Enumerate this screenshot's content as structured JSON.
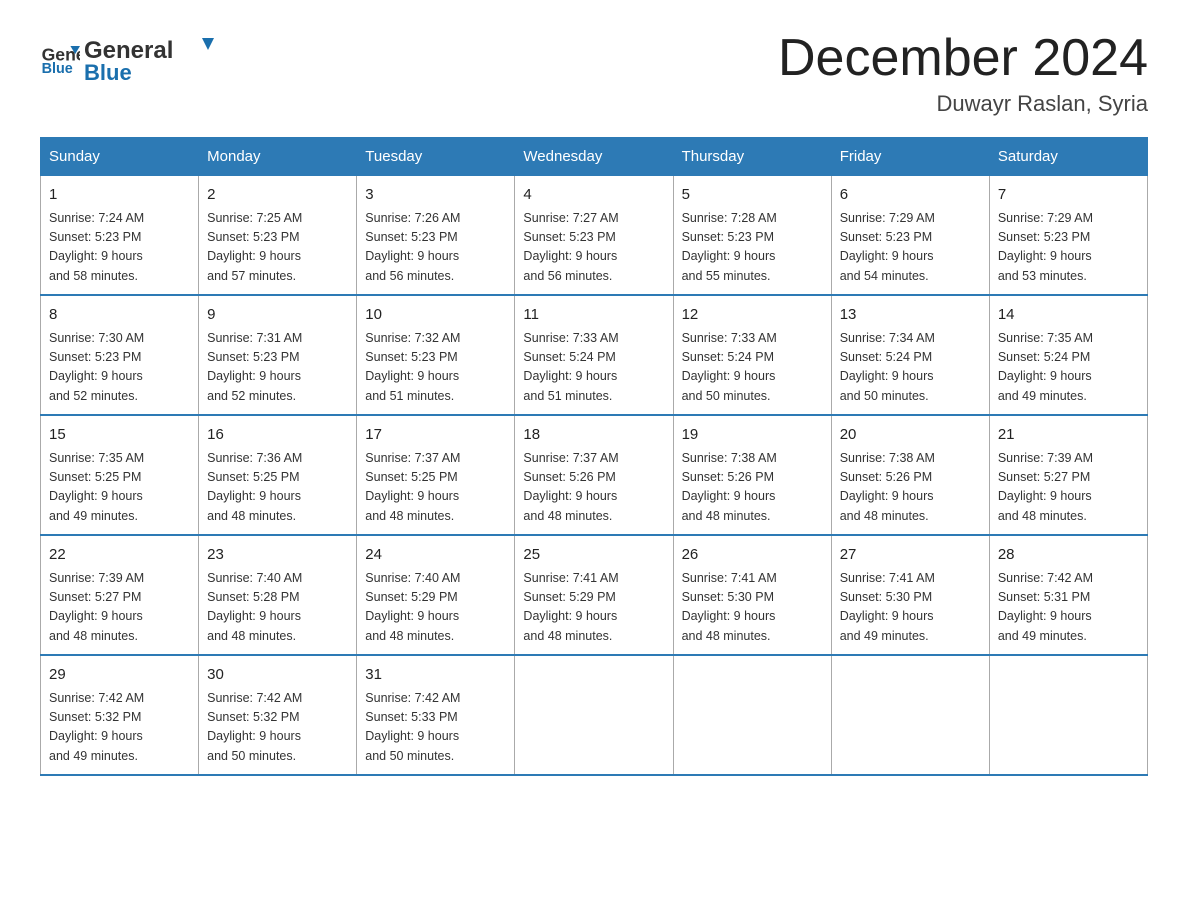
{
  "header": {
    "logo_line1": "General",
    "logo_line2": "Blue",
    "month_title": "December 2024",
    "location": "Duwayr Raslan, Syria"
  },
  "days_of_week": [
    "Sunday",
    "Monday",
    "Tuesday",
    "Wednesday",
    "Thursday",
    "Friday",
    "Saturday"
  ],
  "weeks": [
    [
      {
        "day": "1",
        "sunrise": "7:24 AM",
        "sunset": "5:23 PM",
        "daylight": "9 hours and 58 minutes."
      },
      {
        "day": "2",
        "sunrise": "7:25 AM",
        "sunset": "5:23 PM",
        "daylight": "9 hours and 57 minutes."
      },
      {
        "day": "3",
        "sunrise": "7:26 AM",
        "sunset": "5:23 PM",
        "daylight": "9 hours and 56 minutes."
      },
      {
        "day": "4",
        "sunrise": "7:27 AM",
        "sunset": "5:23 PM",
        "daylight": "9 hours and 56 minutes."
      },
      {
        "day": "5",
        "sunrise": "7:28 AM",
        "sunset": "5:23 PM",
        "daylight": "9 hours and 55 minutes."
      },
      {
        "day": "6",
        "sunrise": "7:29 AM",
        "sunset": "5:23 PM",
        "daylight": "9 hours and 54 minutes."
      },
      {
        "day": "7",
        "sunrise": "7:29 AM",
        "sunset": "5:23 PM",
        "daylight": "9 hours and 53 minutes."
      }
    ],
    [
      {
        "day": "8",
        "sunrise": "7:30 AM",
        "sunset": "5:23 PM",
        "daylight": "9 hours and 52 minutes."
      },
      {
        "day": "9",
        "sunrise": "7:31 AM",
        "sunset": "5:23 PM",
        "daylight": "9 hours and 52 minutes."
      },
      {
        "day": "10",
        "sunrise": "7:32 AM",
        "sunset": "5:23 PM",
        "daylight": "9 hours and 51 minutes."
      },
      {
        "day": "11",
        "sunrise": "7:33 AM",
        "sunset": "5:24 PM",
        "daylight": "9 hours and 51 minutes."
      },
      {
        "day": "12",
        "sunrise": "7:33 AM",
        "sunset": "5:24 PM",
        "daylight": "9 hours and 50 minutes."
      },
      {
        "day": "13",
        "sunrise": "7:34 AM",
        "sunset": "5:24 PM",
        "daylight": "9 hours and 50 minutes."
      },
      {
        "day": "14",
        "sunrise": "7:35 AM",
        "sunset": "5:24 PM",
        "daylight": "9 hours and 49 minutes."
      }
    ],
    [
      {
        "day": "15",
        "sunrise": "7:35 AM",
        "sunset": "5:25 PM",
        "daylight": "9 hours and 49 minutes."
      },
      {
        "day": "16",
        "sunrise": "7:36 AM",
        "sunset": "5:25 PM",
        "daylight": "9 hours and 48 minutes."
      },
      {
        "day": "17",
        "sunrise": "7:37 AM",
        "sunset": "5:25 PM",
        "daylight": "9 hours and 48 minutes."
      },
      {
        "day": "18",
        "sunrise": "7:37 AM",
        "sunset": "5:26 PM",
        "daylight": "9 hours and 48 minutes."
      },
      {
        "day": "19",
        "sunrise": "7:38 AM",
        "sunset": "5:26 PM",
        "daylight": "9 hours and 48 minutes."
      },
      {
        "day": "20",
        "sunrise": "7:38 AM",
        "sunset": "5:26 PM",
        "daylight": "9 hours and 48 minutes."
      },
      {
        "day": "21",
        "sunrise": "7:39 AM",
        "sunset": "5:27 PM",
        "daylight": "9 hours and 48 minutes."
      }
    ],
    [
      {
        "day": "22",
        "sunrise": "7:39 AM",
        "sunset": "5:27 PM",
        "daylight": "9 hours and 48 minutes."
      },
      {
        "day": "23",
        "sunrise": "7:40 AM",
        "sunset": "5:28 PM",
        "daylight": "9 hours and 48 minutes."
      },
      {
        "day": "24",
        "sunrise": "7:40 AM",
        "sunset": "5:29 PM",
        "daylight": "9 hours and 48 minutes."
      },
      {
        "day": "25",
        "sunrise": "7:41 AM",
        "sunset": "5:29 PM",
        "daylight": "9 hours and 48 minutes."
      },
      {
        "day": "26",
        "sunrise": "7:41 AM",
        "sunset": "5:30 PM",
        "daylight": "9 hours and 48 minutes."
      },
      {
        "day": "27",
        "sunrise": "7:41 AM",
        "sunset": "5:30 PM",
        "daylight": "9 hours and 49 minutes."
      },
      {
        "day": "28",
        "sunrise": "7:42 AM",
        "sunset": "5:31 PM",
        "daylight": "9 hours and 49 minutes."
      }
    ],
    [
      {
        "day": "29",
        "sunrise": "7:42 AM",
        "sunset": "5:32 PM",
        "daylight": "9 hours and 49 minutes."
      },
      {
        "day": "30",
        "sunrise": "7:42 AM",
        "sunset": "5:32 PM",
        "daylight": "9 hours and 50 minutes."
      },
      {
        "day": "31",
        "sunrise": "7:42 AM",
        "sunset": "5:33 PM",
        "daylight": "9 hours and 50 minutes."
      },
      null,
      null,
      null,
      null
    ]
  ],
  "labels": {
    "sunrise": "Sunrise: ",
    "sunset": "Sunset: ",
    "daylight": "Daylight: "
  }
}
